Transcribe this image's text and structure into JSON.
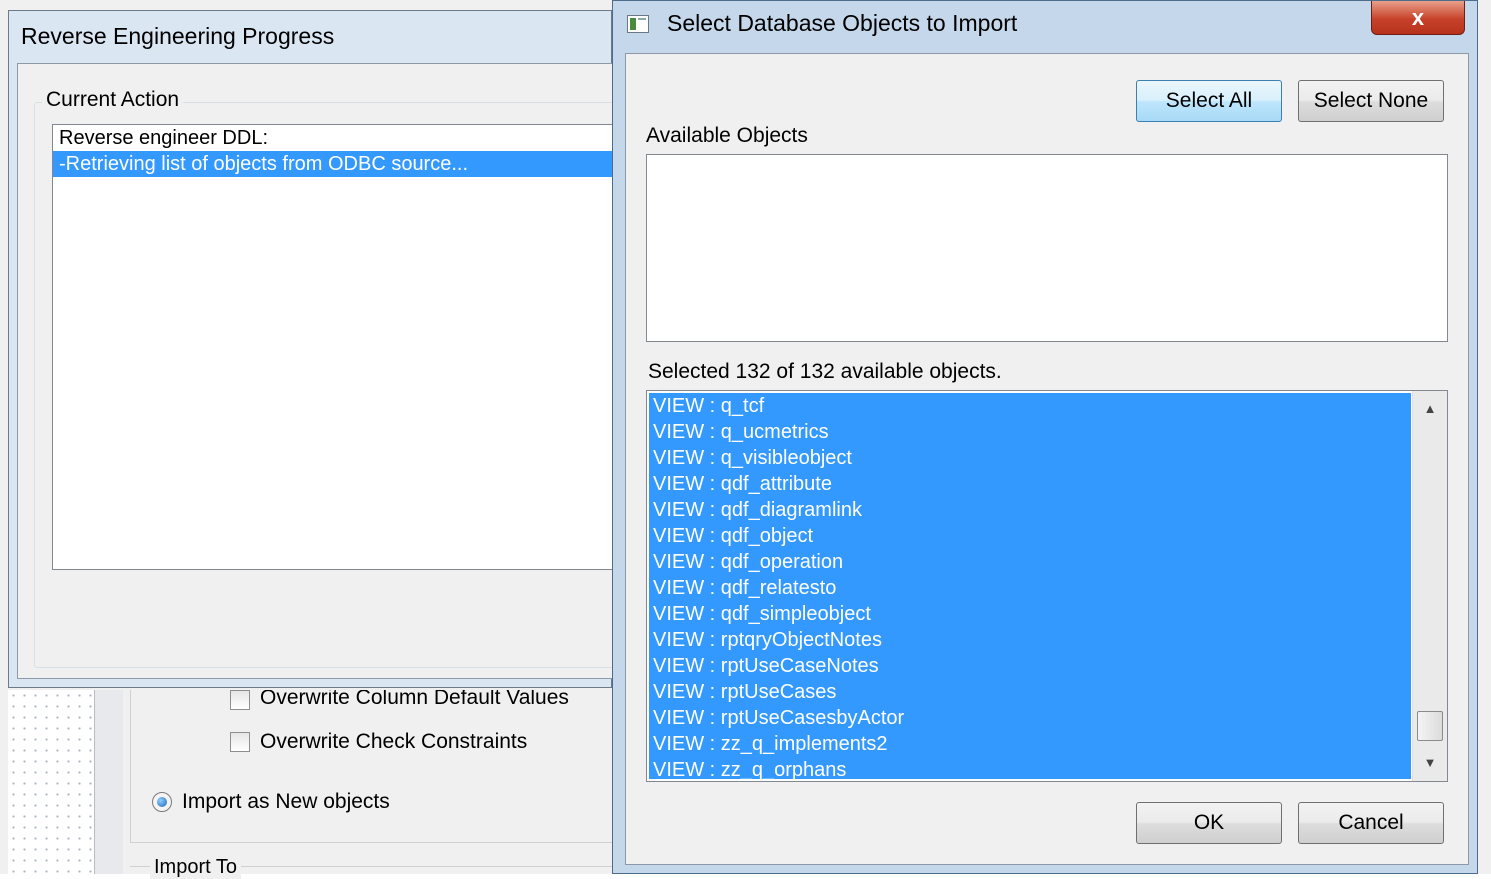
{
  "background": {
    "options": [
      {
        "label": "Overwrite Column Default Values",
        "checked": false
      },
      {
        "label": "Overwrite Check Constraints",
        "checked": false
      }
    ],
    "radio_label": "Import as New objects",
    "import_to_label": "Import To"
  },
  "progress": {
    "title": "Reverse Engineering Progress",
    "group_label": "Current Action",
    "lines": [
      "Reverse engineer DDL:",
      "-Retrieving list of objects from ODBC source..."
    ]
  },
  "dialog": {
    "title": "Select Database Objects to Import",
    "close_glyph": "x",
    "select_all": "Select All",
    "select_none": "Select None",
    "available_label": "Available Objects",
    "selected_status": "Selected 132 of 132 available objects.",
    "objects": [
      "VIEW : q_tcf",
      "VIEW : q_ucmetrics",
      "VIEW : q_visibleobject",
      "VIEW : qdf_attribute",
      "VIEW : qdf_diagramlink",
      "VIEW : qdf_object",
      "VIEW : qdf_operation",
      "VIEW : qdf_relatesto",
      "VIEW : qdf_simpleobject",
      "VIEW : rptqryObjectNotes",
      "VIEW : rptUseCaseNotes",
      "VIEW : rptUseCases",
      "VIEW : rptUseCasesbyActor",
      "VIEW : zz_q_implements2",
      "VIEW : zz_q_orphans"
    ],
    "ok": "OK",
    "cancel": "Cancel"
  },
  "colors": {
    "selection": "#3399ff",
    "dialog_frame": "#c5d7ea",
    "close_button": "#c7422a"
  }
}
